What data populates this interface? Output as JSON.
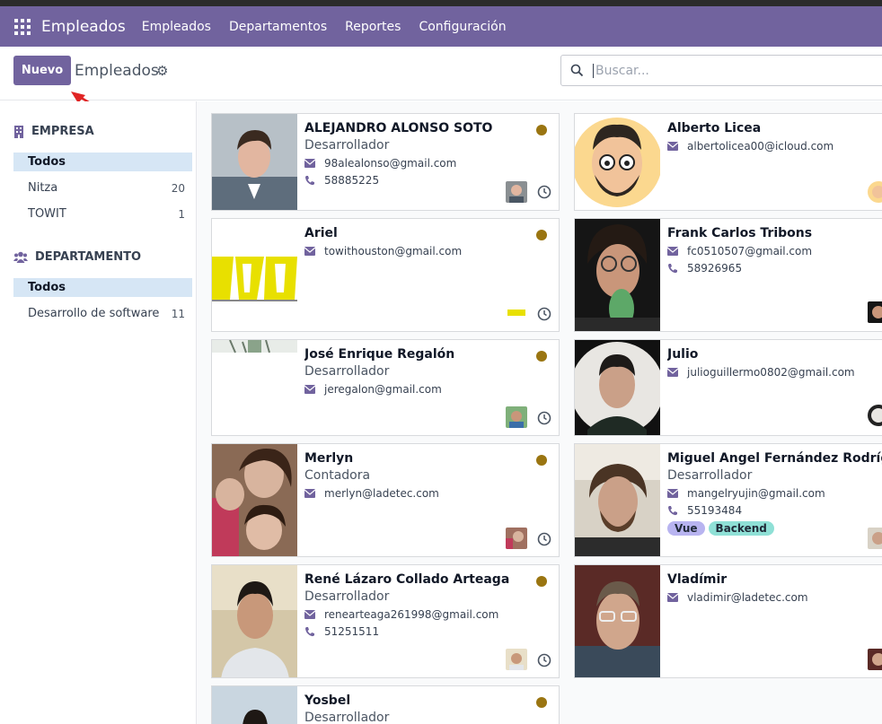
{
  "navbar": {
    "app_title": "Empleados",
    "menu": [
      "Empleados",
      "Departamentos",
      "Reportes",
      "Configuración"
    ]
  },
  "control_panel": {
    "new_button": "Nuevo",
    "view_title": "Empleados",
    "search_placeholder": "Buscar..."
  },
  "sidebar": {
    "company": {
      "heading": "EMPRESA",
      "items": [
        {
          "label": "Todos",
          "count": ""
        },
        {
          "label": "Nitza",
          "count": "20"
        },
        {
          "label": "TOWIT",
          "count": "1"
        }
      ]
    },
    "department": {
      "heading": "DEPARTAMENTO",
      "items": [
        {
          "label": "Todos",
          "count": ""
        },
        {
          "label": "Desarrollo de software",
          "count": "11"
        }
      ]
    }
  },
  "employees": [
    {
      "name": "ALEJANDRO ALONSO SOTO",
      "job": "Desarrollador",
      "email": "98alealonso@gmail.com",
      "phone": "58885225"
    },
    {
      "name": "Alberto Licea",
      "job": "",
      "email": "albertolicea00@icloud.com",
      "phone": ""
    },
    {
      "name": "Ariel",
      "job": "",
      "email": "towithouston@gmail.com",
      "phone": ""
    },
    {
      "name": "Frank Carlos Tribons",
      "job": "",
      "email": "fc0510507@gmail.com",
      "phone": "58926965"
    },
    {
      "name": "José Enrique Regalón",
      "job": "Desarrollador",
      "email": "jeregalon@gmail.com",
      "phone": ""
    },
    {
      "name": "Julio",
      "job": "",
      "email": "julioguillermo0802@gmail.com",
      "phone": ""
    },
    {
      "name": "Merlyn",
      "job": "Contadora",
      "email": "merlyn@ladetec.com",
      "phone": ""
    },
    {
      "name": "Miguel Angel Fernández Rodríguez",
      "job": "Desarrollador",
      "email": "mangelryujin@gmail.com",
      "phone": "55193484",
      "tags": [
        "Vue",
        "Backend"
      ]
    },
    {
      "name": "René Lázaro Collado Arteaga",
      "job": "Desarrollador",
      "email": "renearteaga261998@gmail.com",
      "phone": "51251511"
    },
    {
      "name": "Vladímir",
      "job": "",
      "email": "vladimir@ladetec.com",
      "phone": ""
    },
    {
      "name": "Yosbel",
      "job": "Desarrollador",
      "email": "",
      "phone": ""
    }
  ],
  "colors": {
    "brand": "#71639e",
    "status_away": "#9a7511",
    "tag_vue": "#b8b4f0",
    "tag_backend": "#8fe0d6",
    "active_filter": "#d6e6f5"
  },
  "icons": [
    "apps-grid-icon",
    "gear-icon",
    "search-icon",
    "building-icon",
    "users-icon",
    "envelope-icon",
    "phone-icon",
    "clock-icon"
  ]
}
